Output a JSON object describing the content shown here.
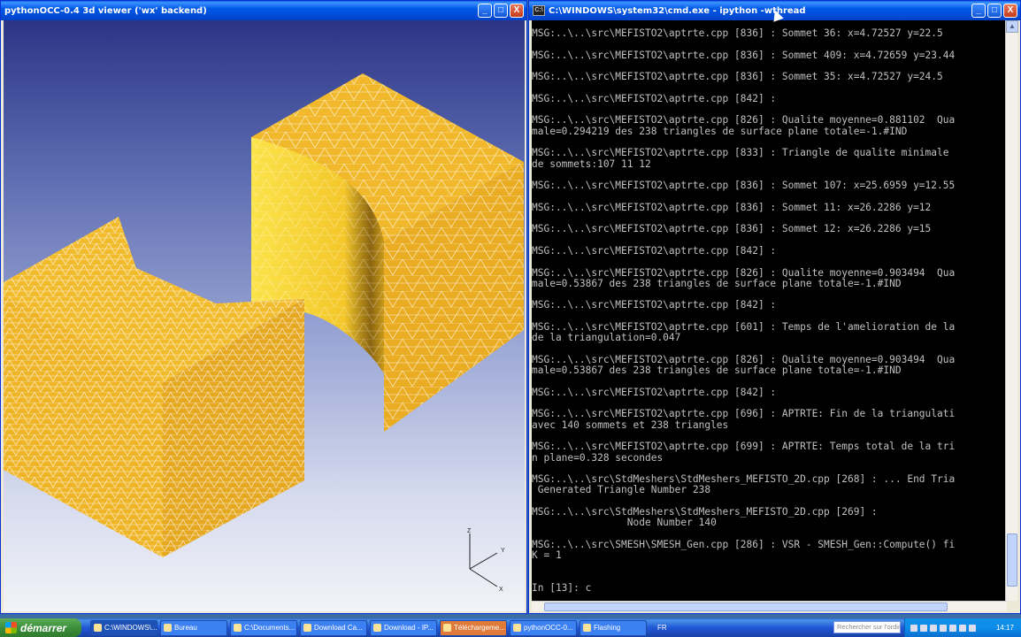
{
  "viewer_window": {
    "title": "pythonOCC-0.4 3d viewer ('wx' backend)",
    "buttons": [
      "_",
      "□",
      "X"
    ],
    "axes": {
      "z": "Z",
      "y": "Y",
      "x": "X"
    },
    "colors": {
      "shape_fill": "#f2b92c",
      "shape_shadow": "#e0a218",
      "mesh": "#ffffff"
    }
  },
  "console_window": {
    "title": "C:\\WINDOWS\\system32\\cmd.exe - ipython -wthread",
    "icon": "C:\\",
    "buttons": [
      "_",
      "□",
      "X"
    ],
    "lines": [
      "MSG:..\\..\\src\\MEFISTO2\\aptrte.cpp [836] : Sommet 36: x=4.72527 y=22.5",
      "",
      "MSG:..\\..\\src\\MEFISTO2\\aptrte.cpp [836] : Sommet 409: x=4.72659 y=23.44",
      "",
      "MSG:..\\..\\src\\MEFISTO2\\aptrte.cpp [836] : Sommet 35: x=4.72527 y=24.5",
      "",
      "MSG:..\\..\\src\\MEFISTO2\\aptrte.cpp [842] :",
      "",
      "MSG:..\\..\\src\\MEFISTO2\\aptrte.cpp [826] : Qualite moyenne=0.881102  Qua",
      "male=0.294219 des 238 triangles de surface plane totale=-1.#IND",
      "",
      "MSG:..\\..\\src\\MEFISTO2\\aptrte.cpp [833] : Triangle de qualite minimale",
      "de sommets:107 11 12",
      "",
      "MSG:..\\..\\src\\MEFISTO2\\aptrte.cpp [836] : Sommet 107: x=25.6959 y=12.55",
      "",
      "MSG:..\\..\\src\\MEFISTO2\\aptrte.cpp [836] : Sommet 11: x=26.2286 y=12",
      "",
      "MSG:..\\..\\src\\MEFISTO2\\aptrte.cpp [836] : Sommet 12: x=26.2286 y=15",
      "",
      "MSG:..\\..\\src\\MEFISTO2\\aptrte.cpp [842] :",
      "",
      "MSG:..\\..\\src\\MEFISTO2\\aptrte.cpp [826] : Qualite moyenne=0.903494  Qua",
      "male=0.53867 des 238 triangles de surface plane totale=-1.#IND",
      "",
      "MSG:..\\..\\src\\MEFISTO2\\aptrte.cpp [842] :",
      "",
      "MSG:..\\..\\src\\MEFISTO2\\aptrte.cpp [601] : Temps de l'amelioration de la",
      "de la triangulation=0.047",
      "",
      "MSG:..\\..\\src\\MEFISTO2\\aptrte.cpp [826] : Qualite moyenne=0.903494  Qua",
      "male=0.53867 des 238 triangles de surface plane totale=-1.#IND",
      "",
      "MSG:..\\..\\src\\MEFISTO2\\aptrte.cpp [842] :",
      "",
      "MSG:..\\..\\src\\MEFISTO2\\aptrte.cpp [696] : APTRTE: Fin de la triangulati",
      "avec 140 sommets et 238 triangles",
      "",
      "MSG:..\\..\\src\\MEFISTO2\\aptrte.cpp [699] : APTRTE: Temps total de la tri",
      "n plane=0.328 secondes",
      "",
      "MSG:..\\..\\src\\StdMeshers\\StdMeshers_MEFISTO_2D.cpp [268] : ... End Tria",
      " Generated Triangle Number 238",
      "",
      "MSG:..\\..\\src\\StdMeshers\\StdMeshers_MEFISTO_2D.cpp [269] :",
      "                Node Number 140",
      "",
      "MSG:..\\..\\src\\SMESH\\SMESH_Gen.cpp [286] : VSR - SMESH_Gen::Compute() fi",
      "K = 1",
      "",
      "",
      "In [13]: c"
    ]
  },
  "taskbar": {
    "start_label": "démarrer",
    "tasks": [
      {
        "label": "C:\\WINDOWS\\...",
        "active": true,
        "icon": "console-icon"
      },
      {
        "label": "Bureau",
        "active": false,
        "icon": "desktop-icon"
      },
      {
        "label": "C:\\Documents...",
        "active": false,
        "icon": "folder-icon"
      },
      {
        "label": "Download Ca...",
        "active": false,
        "icon": "firefox-icon"
      },
      {
        "label": "Download - IP...",
        "active": false,
        "icon": "firefox-icon"
      },
      {
        "label": "Téléchargeme...",
        "active": false,
        "icon": "download-icon",
        "highlight": true
      },
      {
        "label": "pythonOCC-0...",
        "active": false,
        "icon": "python-icon"
      },
      {
        "label": "Flashing",
        "active": false,
        "icon": "flash-icon"
      }
    ],
    "language": "FR",
    "search_placeholder": "Rechercher sur l'ordin",
    "clock": "14:17"
  }
}
